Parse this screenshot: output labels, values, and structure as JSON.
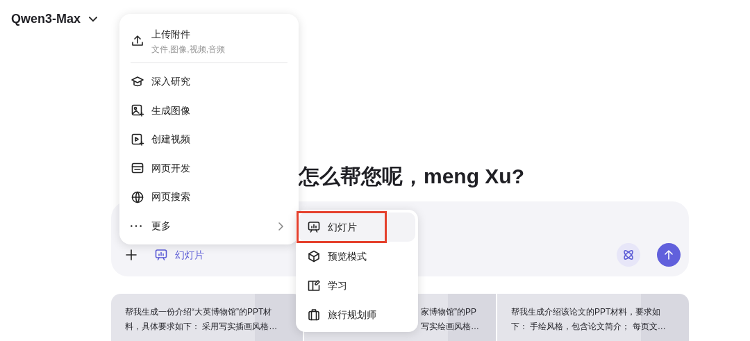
{
  "model_selector": {
    "label": "Qwen3-Max"
  },
  "greeting": "怎么帮您呢，meng Xu?",
  "composer": {
    "tool_tag": {
      "label": "幻灯片"
    }
  },
  "attach_menu": {
    "items": [
      {
        "kind": "upload",
        "label": "上传附件",
        "subtitle": "文件,图像,视频,音频"
      },
      {
        "kind": "research",
        "label": "深入研究"
      },
      {
        "kind": "image",
        "label": "生成图像"
      },
      {
        "kind": "video",
        "label": "创建视频"
      },
      {
        "kind": "web",
        "label": "网页开发"
      },
      {
        "kind": "search",
        "label": "网页搜索"
      },
      {
        "kind": "more",
        "label": "更多"
      }
    ]
  },
  "submenu": {
    "items": [
      {
        "kind": "slides",
        "label": "幻灯片",
        "selected": true,
        "highlighted": true
      },
      {
        "kind": "preview",
        "label": "预览模式",
        "selected": false,
        "highlighted": false
      },
      {
        "kind": "learn",
        "label": "学习",
        "selected": false,
        "highlighted": false
      },
      {
        "kind": "travel",
        "label": "旅行规划师",
        "selected": false,
        "highlighted": false
      }
    ]
  },
  "suggestions": [
    {
      "lines": [
        "帮我生成一份介绍“大英博物馆”的PPT材",
        "料，具体要求如下： 采用写实插画风格…"
      ]
    },
    {
      "lines": [
        "家博物馆”的PP",
        "写实绘画风格…"
      ]
    },
    {
      "lines": [
        "帮我生成介绍该论文的PPT材料，要求如",
        "下： 手绘风格，包含论文简介； 每页文…"
      ]
    }
  ]
}
